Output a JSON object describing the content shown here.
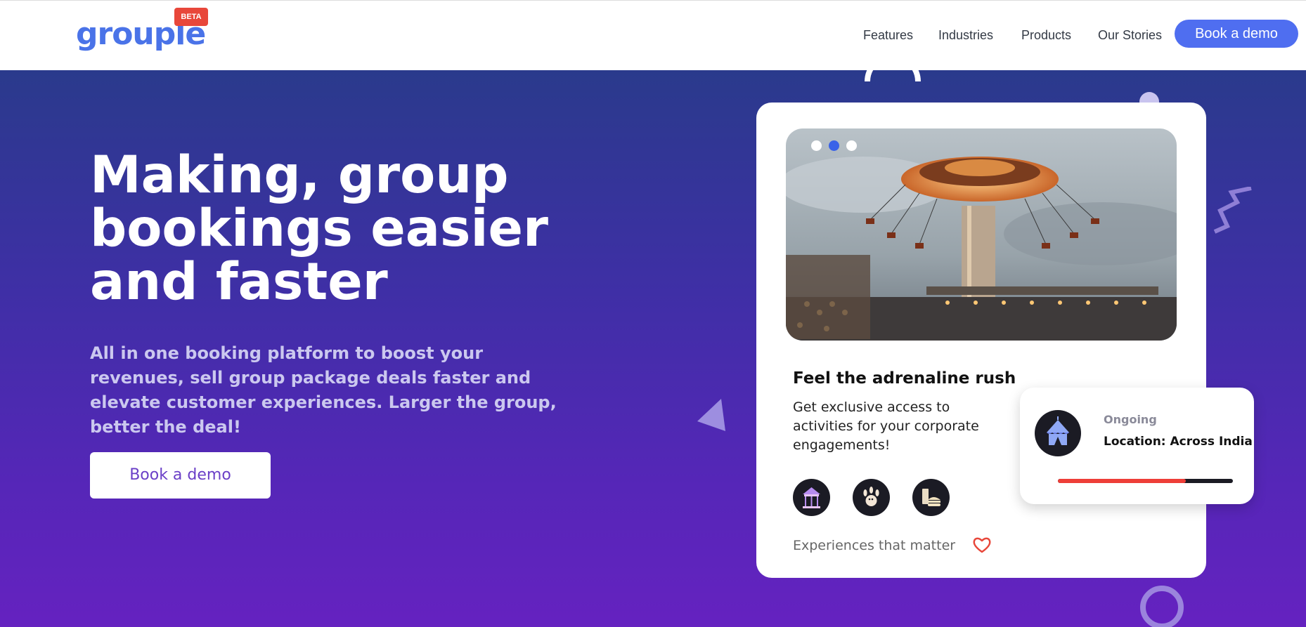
{
  "brand": {
    "name": "grouple",
    "badge": "BETA"
  },
  "nav": {
    "links": [
      "Features",
      "Industries",
      "Products",
      "Our Stories"
    ],
    "cta": "Book a demo"
  },
  "hero": {
    "title": "Making, group bookings easier and faster",
    "subtitle": "All in one booking platform to boost your revenues, sell group package deals faster and elevate customer experiences. Larger the group, better the deal!",
    "cta": "Book a demo"
  },
  "card": {
    "carousel": {
      "total": 3,
      "active": 2
    },
    "title": "Feel the adrenaline rush",
    "description": "Get exclusive access to activities for your corporate engagements!",
    "activity_icons": [
      "carousel-icon",
      "bowling-icon",
      "food-icon"
    ],
    "footer": "Experiences that matter"
  },
  "status": {
    "label": "Ongoing",
    "location": "Location: Across India",
    "progress": 0.73
  },
  "colors": {
    "brand": "#4a73e8",
    "cta": "#4f6ef0",
    "hero_top": "#2a3a8c",
    "hero_bottom": "#6522c0",
    "badge": "#e8473a",
    "progress_fill": "#ee3e38"
  }
}
